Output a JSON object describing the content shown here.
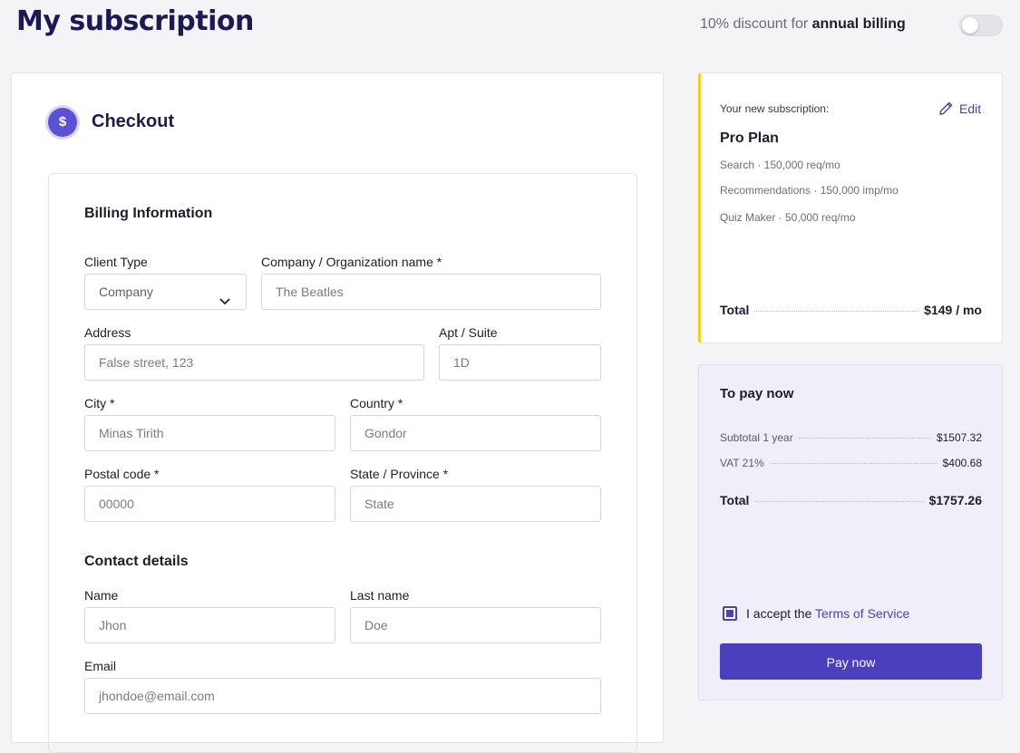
{
  "header": {
    "title": "My subscription",
    "discount_prefix": "10% discount for ",
    "discount_bold": "annual billing",
    "annual_billing_toggle": "off"
  },
  "checkout": {
    "title": "Checkout",
    "icon": "dollar-icon",
    "billing": {
      "title": "Billing Information",
      "client_type": {
        "label": "Client Type",
        "value": "Company"
      },
      "company_name": {
        "label": "Company / Organization name *",
        "placeholder": "The Beatles"
      },
      "address": {
        "label": "Address",
        "placeholder": "False street, 123"
      },
      "apt": {
        "label": "Apt / Suite",
        "placeholder": "1D"
      },
      "city": {
        "label": "City *",
        "placeholder": "Minas Tirith"
      },
      "country": {
        "label": "Country *",
        "placeholder": "Gondor"
      },
      "postal": {
        "label": "Postal code *",
        "placeholder": "00000"
      },
      "state": {
        "label": "State / Province *",
        "placeholder": "State"
      }
    },
    "contact": {
      "title": "Contact details",
      "name": {
        "label": "Name",
        "placeholder": "Jhon"
      },
      "last_name": {
        "label": "Last name",
        "placeholder": "Doe"
      },
      "email": {
        "label": "Email",
        "placeholder": "jhondoe@email.com"
      }
    }
  },
  "subscription": {
    "label": "Your new subscription:",
    "edit_label": "Edit",
    "plan": "Pro Plan",
    "features": [
      "Search · 150,000 req/mo",
      "Recommendations · 150,000 imp/mo",
      "Quiz Maker · 50,000 req/mo"
    ],
    "total_label": "Total",
    "total_value": "$149 / mo"
  },
  "payment": {
    "title": "To pay now",
    "subtotal_label": "Subtotal 1 year",
    "subtotal_value": "$1507.32",
    "vat_label": "VAT 21%",
    "vat_value": "$400.68",
    "total_label": "Total",
    "total_value": "$1757.26",
    "accept_prefix": "I accept the ",
    "terms_link": "Terms of Service",
    "pay_button": "Pay now"
  },
  "colors": {
    "accent": "#4a3fbd",
    "title": "#1c1a55",
    "highlight_border": "#f1d21c",
    "pay_panel_bg": "#efeef9"
  }
}
